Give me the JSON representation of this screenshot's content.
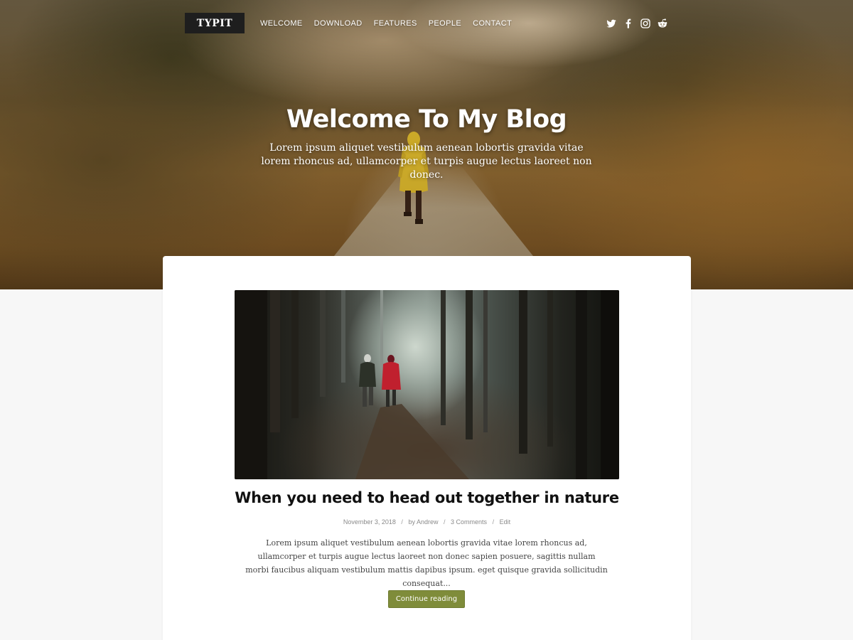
{
  "site": {
    "logo": "TYPIT"
  },
  "nav": {
    "items": [
      "WELCOME",
      "DOWNLOAD",
      "FEATURES",
      "PEOPLE",
      "CONTACT"
    ]
  },
  "social": {
    "icons": [
      "twitter-icon",
      "facebook-icon",
      "instagram-icon",
      "reddit-icon"
    ]
  },
  "hero": {
    "title": "Welcome To My Blog",
    "subtitle": "Lorem ipsum aliquet vestibulum aenean lobortis gravida vitae lorem rhoncus ad, ullamcorper et turpis augue lectus laoreet non donec."
  },
  "post": {
    "title": "When you need to head out together in nature",
    "date": "November 3, 2018",
    "separator": "/",
    "author": "by Andrew",
    "comments": "3 Comments",
    "edit": "Edit",
    "excerpt": "Lorem ipsum aliquet vestibulum aenean lobortis gravida vitae lorem rhoncus ad, ullamcorper et turpis augue lectus laoreet non donec sapien posuere, sagittis nullam morbi faucibus aliquam vestibulum mattis dapibus ipsum. eget quisque gravida sollicitudin consequat...",
    "continue_label": "Continue reading"
  },
  "colors": {
    "accent": "#7f8c3a",
    "logo_bg": "#1e1e1e",
    "page_bg": "#f7f7f7"
  }
}
